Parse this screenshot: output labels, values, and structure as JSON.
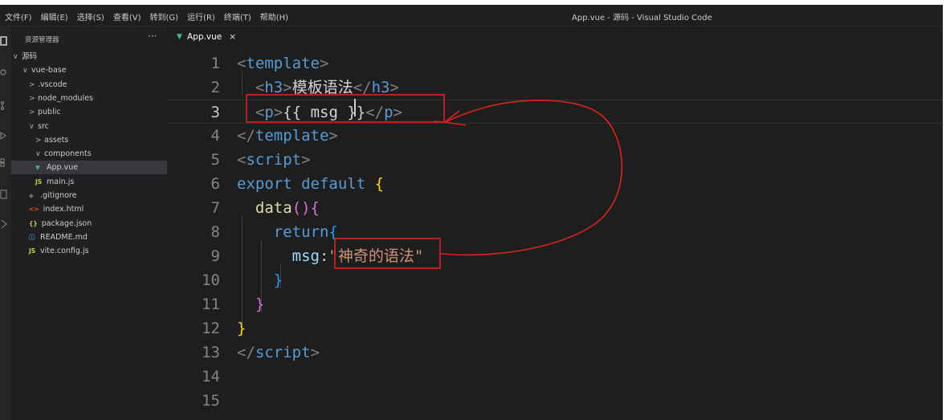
{
  "window": {
    "title": "App.vue - 源码 - Visual Studio Code",
    "menu": [
      "文件(F)",
      "编辑(E)",
      "选择(S)",
      "查看(V)",
      "转到(G)",
      "运行(R)",
      "终端(T)",
      "帮助(H)"
    ]
  },
  "sidebar": {
    "header": "资源管理器",
    "more": "···",
    "items": [
      {
        "label": "源码",
        "arrow": "∨",
        "icon": "",
        "icon_name": "folder-open"
      },
      {
        "label": "vue-base",
        "arrow": "∨",
        "icon": "",
        "icon_name": "folder-open"
      },
      {
        "label": ".vscode",
        "arrow": ">",
        "icon": "",
        "icon_name": "folder"
      },
      {
        "label": "node_modules",
        "arrow": ">",
        "icon": "",
        "icon_name": "folder"
      },
      {
        "label": "public",
        "arrow": ">",
        "icon": "",
        "icon_name": "folder"
      },
      {
        "label": "src",
        "arrow": "∨",
        "icon": "",
        "icon_name": "folder-open"
      },
      {
        "label": "assets",
        "arrow": ">",
        "icon": "",
        "icon_name": "folder"
      },
      {
        "label": "components",
        "arrow": "∨",
        "icon": "",
        "icon_name": "folder-open"
      },
      {
        "label": "App.vue",
        "arrow": "",
        "icon": "▼",
        "icon_name": "vue-file",
        "color": "#41b883",
        "active": true
      },
      {
        "label": "main.js",
        "arrow": "",
        "icon": "JS",
        "icon_name": "js-file",
        "color": "#cbcb41"
      },
      {
        "label": ".gitignore",
        "arrow": "",
        "icon": "◆",
        "icon_name": "git-file",
        "color": "#6d6d6d"
      },
      {
        "label": "index.html",
        "arrow": "",
        "icon": "<>",
        "icon_name": "html-file",
        "color": "#e44d26"
      },
      {
        "label": "package.json",
        "arrow": "",
        "icon": "{}",
        "icon_name": "json-file",
        "color": "#cbcb41"
      },
      {
        "label": "README.md",
        "arrow": "",
        "icon": "ⓘ",
        "icon_name": "info-file",
        "color": "#519aba"
      },
      {
        "label": "vite.config.js",
        "arrow": "",
        "icon": "JS",
        "icon_name": "js-file",
        "color": "#cbcb41"
      }
    ]
  },
  "tab": {
    "label": "App.vue",
    "close": "×"
  },
  "editor": {
    "current_line": 3,
    "lines": [
      {
        "num": "1",
        "tokens": [
          [
            "<",
            "punct"
          ],
          [
            "template",
            "tag"
          ],
          [
            ">",
            "punct"
          ]
        ]
      },
      {
        "num": "2",
        "tokens": [
          [
            "  ",
            ""
          ],
          [
            "<",
            "punct"
          ],
          [
            "h3",
            "tag"
          ],
          [
            ">",
            "punct"
          ],
          [
            "模板语法",
            "text"
          ],
          [
            "</",
            "punct"
          ],
          [
            "h3",
            "tag"
          ],
          [
            ">",
            "punct"
          ]
        ]
      },
      {
        "num": "3",
        "tokens": [
          [
            "  ",
            ""
          ],
          [
            "<",
            "punct"
          ],
          [
            "p",
            "tag"
          ],
          [
            ">",
            "punct"
          ],
          [
            "{{ msg }}",
            "text"
          ],
          [
            "</",
            "punct"
          ],
          [
            "p",
            "tag"
          ],
          [
            ">",
            "punct"
          ]
        ]
      },
      {
        "num": "4",
        "tokens": [
          [
            "</",
            "punct"
          ],
          [
            "template",
            "tag"
          ],
          [
            ">",
            "punct"
          ]
        ]
      },
      {
        "num": "5",
        "tokens": [
          [
            "<",
            "punct"
          ],
          [
            "script",
            "tag"
          ],
          [
            ">",
            "punct"
          ]
        ]
      },
      {
        "num": "6",
        "tokens": [
          [
            "export default ",
            "key"
          ],
          [
            "{",
            "b1"
          ]
        ]
      },
      {
        "num": "7",
        "tokens": [
          [
            "  ",
            ""
          ],
          [
            "data",
            "func"
          ],
          [
            "()",
            "b2"
          ],
          [
            "{",
            "b2"
          ]
        ]
      },
      {
        "num": "8",
        "tokens": [
          [
            "    ",
            ""
          ],
          [
            "return",
            "key"
          ],
          [
            "{",
            "b3"
          ]
        ]
      },
      {
        "num": "9",
        "tokens": [
          [
            "      ",
            ""
          ],
          [
            "msg",
            "prop"
          ],
          [
            ":",
            "text"
          ],
          [
            "\"神奇的语法\"",
            "str"
          ]
        ]
      },
      {
        "num": "10",
        "tokens": [
          [
            "    ",
            ""
          ],
          [
            "}",
            "b3"
          ]
        ]
      },
      {
        "num": "11",
        "tokens": [
          [
            "  ",
            ""
          ],
          [
            "}",
            "b2"
          ]
        ]
      },
      {
        "num": "12",
        "tokens": [
          [
            "}",
            "b1"
          ]
        ]
      },
      {
        "num": "13",
        "tokens": [
          [
            "</",
            "punct"
          ],
          [
            "script",
            "tag"
          ],
          [
            ">",
            "punct"
          ]
        ]
      },
      {
        "num": "14",
        "tokens": []
      },
      {
        "num": "15",
        "tokens": []
      }
    ]
  },
  "colors": {
    "annotation": "#d9241c",
    "vue": "#41b883"
  }
}
